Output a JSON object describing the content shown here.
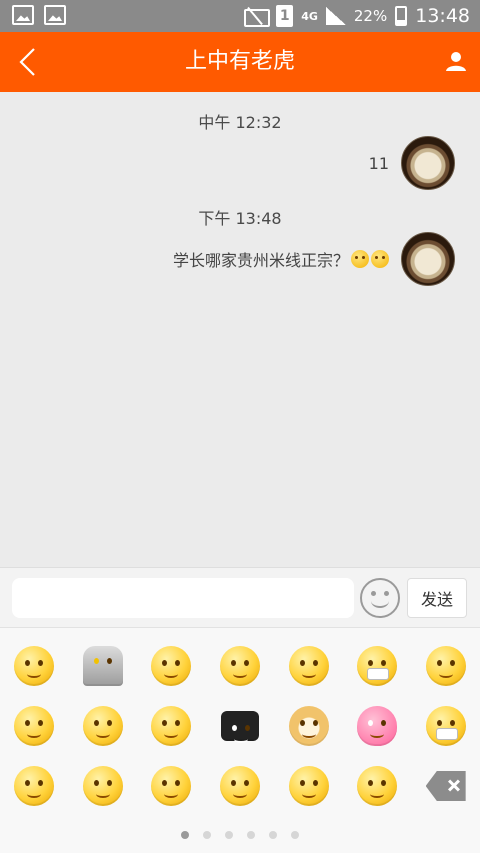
{
  "status_bar": {
    "sim_slot": "1",
    "network": "4G",
    "battery": "22%",
    "time": "13:48"
  },
  "header": {
    "title": "上中有老虎",
    "back_icon": "chevron-left-icon",
    "profile_icon": "person-icon",
    "color": "#ff5a00"
  },
  "messages": [
    {
      "timestamp": "中午 12:32",
      "text": "11",
      "emojis": []
    },
    {
      "timestamp": "下午 13:48",
      "text": "学长哪家贵州米线正宗？",
      "emojis": [
        "blush-emoji",
        "cat-emoji"
      ]
    }
  ],
  "input": {
    "value": "",
    "placeholder": "",
    "send_label": "发送",
    "emoji_toggle_icon": "smiley-icon"
  },
  "emoji_panel": {
    "emojis": [
      "kiss-heart-emoji",
      "ultraman-emoji",
      "thinking-emoji",
      "sad-emoji",
      "fist-emoji",
      "sealed-mouth-emoji",
      "tongue-emoji",
      "shocked-sweat-emoji",
      "yawn-emoji",
      "slap-emoji",
      "10t-tag-emoji",
      "doge-emoji",
      "pink-pill-emoji",
      "mask-emoji",
      "praying-emoji",
      "laugh-emoji",
      "blush-emoji",
      "speechless-sweat-emoji",
      "smile-emoji",
      "meh-emoji",
      "delete-key-icon"
    ],
    "pages": 6,
    "active_page": 1
  }
}
